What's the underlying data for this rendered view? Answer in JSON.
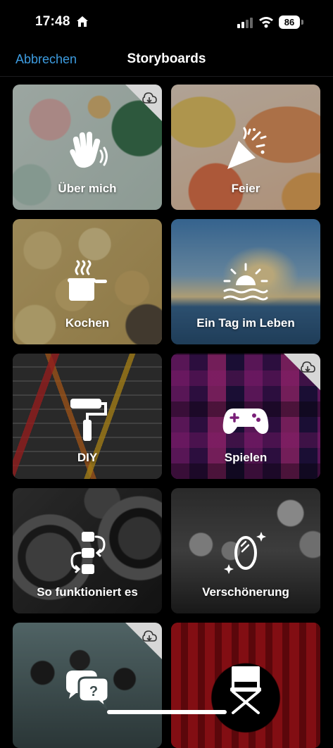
{
  "status_bar": {
    "time": "17:48",
    "battery": "86"
  },
  "nav": {
    "cancel_label": "Abbrechen",
    "title": "Storyboards"
  },
  "tiles": [
    {
      "label": "Über mich",
      "icon": "waving-hand-icon",
      "download": true
    },
    {
      "label": "Feier",
      "icon": "party-popper-icon",
      "download": false
    },
    {
      "label": "Kochen",
      "icon": "cooking-pot-icon",
      "download": false
    },
    {
      "label": "Ein Tag im Leben",
      "icon": "sunset-icon",
      "download": false
    },
    {
      "label": "DIY",
      "icon": "paint-roller-icon",
      "download": false
    },
    {
      "label": "Spielen",
      "icon": "gamepad-icon",
      "download": true
    },
    {
      "label": "So funktioniert es",
      "icon": "process-steps-icon",
      "download": false
    },
    {
      "label": "Verschönerung",
      "icon": "sparkle-mirror-icon",
      "download": false
    },
    {
      "label": "",
      "icon": "speech-bubbles-question-icon",
      "download": true
    },
    {
      "label": "",
      "icon": "director-chair-icon",
      "download": false
    }
  ]
}
